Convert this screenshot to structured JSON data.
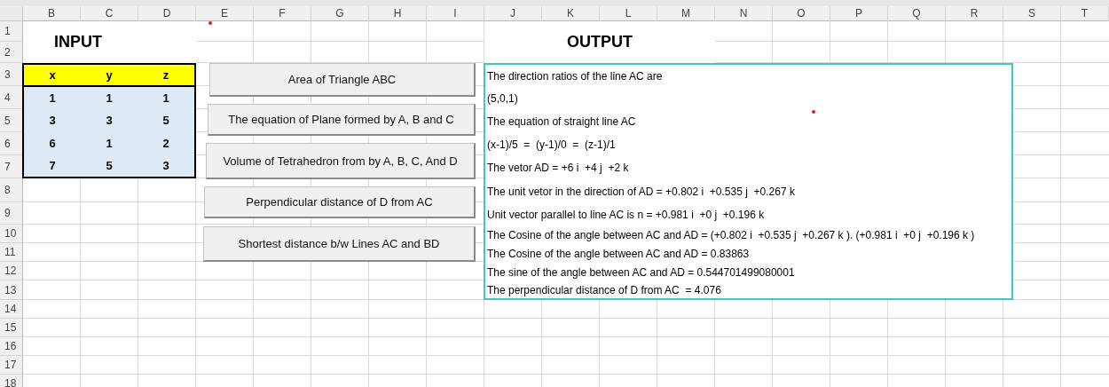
{
  "columns": [
    "B",
    "C",
    "D",
    "E",
    "F",
    "G",
    "H",
    "I",
    "J",
    "K",
    "L",
    "M",
    "N",
    "O",
    "P",
    "Q",
    "R",
    "S",
    "T"
  ],
  "rows": [
    "1",
    "2",
    "3",
    "4",
    "5",
    "6",
    "7",
    "8",
    "9",
    "10",
    "11",
    "12",
    "13",
    "14",
    "15",
    "16",
    "17",
    "18"
  ],
  "input": {
    "title": "INPUT",
    "headers": [
      "x",
      "y",
      "z"
    ],
    "rows": [
      [
        "1",
        "1",
        "1"
      ],
      [
        "3",
        "3",
        "5"
      ],
      [
        "6",
        "1",
        "2"
      ],
      [
        "7",
        "5",
        "3"
      ]
    ]
  },
  "buttons": [
    "Area of Triangle ABC",
    "The equation of Plane formed by A, B and C",
    "Volume of Tetrahedron from by A, B, C, And D",
    "Perpendicular distance of D from AC",
    "Shortest distance b/w Lines AC and BD"
  ],
  "output": {
    "title": "OUTPUT",
    "lines": [
      "The direction ratios of the line AC are",
      "(5,0,1)",
      "The equation of straight line AC",
      "(x-1)/5  =  (y-1)/0  =  (z-1)/1",
      "The vetor AD = +6 i  +4 j  +2 k",
      "The unit vetor in the direction of AD = +0.802 i  +0.535 j  +0.267 k",
      "Unit vector parallel to line AC is n = +0.981 i  +0 j  +0.196 k",
      "The Cosine of the angle between AC and AD = (+0.802 i  +0.535 j  +0.267 k ). (+0.981 i  +0 j  +0.196 k )",
      "The Cosine of the angle between AC and AD = 0.83863",
      "The sine of the angle between AC and AD = 0.544701499080001",
      "The perpendicular distance of D from AC  = 4.076"
    ]
  }
}
